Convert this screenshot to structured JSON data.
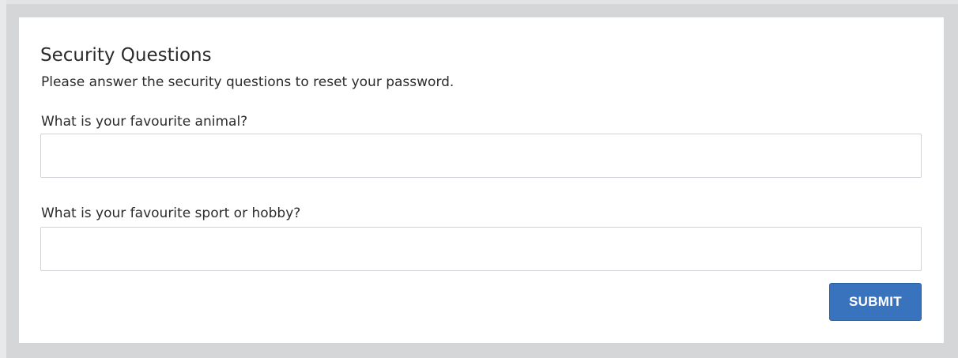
{
  "form": {
    "title": "Security Questions",
    "subtitle": "Please answer the security questions to reset your password.",
    "questions": [
      {
        "label": "What is your favourite animal?",
        "value": "",
        "placeholder": ""
      },
      {
        "label": "What is your favourite sport or hobby?",
        "value": "",
        "placeholder": ""
      }
    ],
    "submit_label": "SUBMIT"
  },
  "colors": {
    "page_background": "#d4d6d8",
    "card_background": "#ffffff",
    "accent": "#3a73bd",
    "text": "#2b2b2b",
    "input_border": "#cfd2d6"
  }
}
